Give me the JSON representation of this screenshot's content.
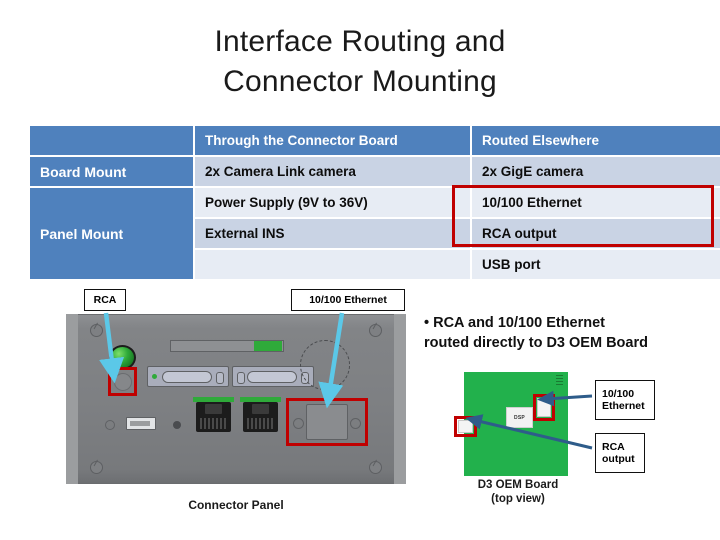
{
  "slide": {
    "title_line1": "Interface Routing and",
    "title_line2": "Connector Mounting"
  },
  "table": {
    "columns": [
      "",
      "Through the Connector Board",
      "Routed Elsewhere"
    ],
    "row_labels": [
      "Board Mount",
      "Panel Mount"
    ],
    "rows": [
      {
        "mount": "Board Mount",
        "through": "2x Camera Link camera",
        "elsewhere": "2x GigE camera"
      },
      {
        "mount": "Panel Mount",
        "through": "Power Supply (9V to 36V)",
        "elsewhere": "10/100 Ethernet"
      },
      {
        "mount": "",
        "through": "External INS",
        "elsewhere": "RCA output"
      },
      {
        "mount": "",
        "through": "",
        "elsewhere": "USB port"
      }
    ],
    "highlight_color": "#C00000",
    "header_color": "#4F81BD",
    "band_dark": "#C9D3E4",
    "band_light": "#E7ECF4"
  },
  "panel": {
    "caption": "Connector Panel",
    "callout_rca": "RCA",
    "callout_ethernet": "10/100 Ethernet",
    "arrow_color": "#5BC8E8"
  },
  "bullet": {
    "line1": "• RCA and 10/100 Ethernet",
    "line2": "routed directly to D3 OEM Board"
  },
  "board": {
    "caption_line1": "D3 OEM Board",
    "caption_line2": "(top view)",
    "chip_label": "DSP",
    "callout_ethernet_line1": "10/100",
    "callout_ethernet_line2": "Ethernet",
    "callout_rca_line1": "RCA",
    "callout_rca_line2": "output",
    "pcb_color": "#22B14C",
    "arrow_color": "#2E5C8A"
  }
}
